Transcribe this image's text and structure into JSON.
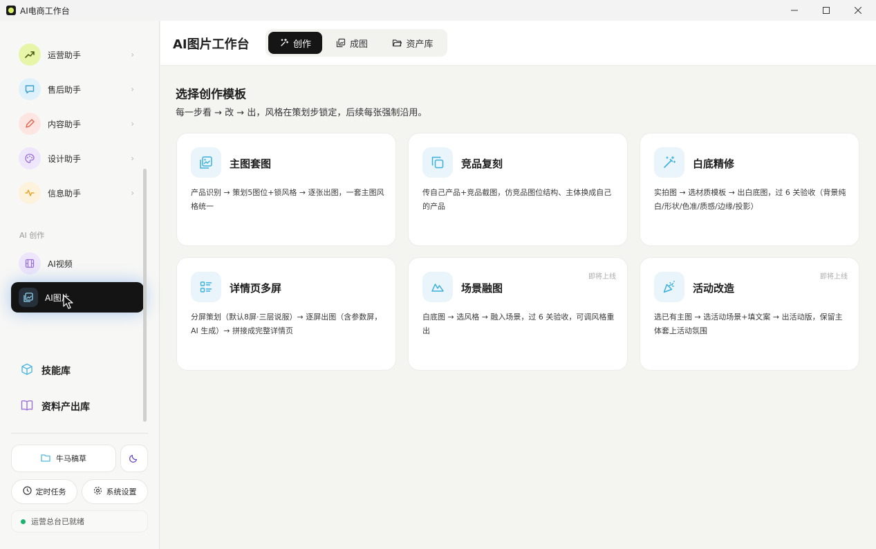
{
  "app": {
    "title": "AI电商工作台"
  },
  "sidebar": {
    "assistants": [
      {
        "label": "运营助手",
        "icon": "trend-up-icon",
        "color": "#e6f5a8"
      },
      {
        "label": "售后助手",
        "icon": "chat-bubble-icon",
        "color": "#dff1fb"
      },
      {
        "label": "内容助手",
        "icon": "pen-icon",
        "color": "#fde6e2"
      },
      {
        "label": "设计助手",
        "icon": "palette-icon",
        "color": "#eee6fa"
      },
      {
        "label": "信息助手",
        "icon": "pulse-icon",
        "color": "#fdf2dc"
      }
    ],
    "section_label": "AI 创作",
    "creation": [
      {
        "label": "AI视频",
        "icon": "film-icon"
      },
      {
        "label": "AI图片",
        "icon": "image-icon"
      }
    ],
    "library": [
      {
        "label": "技能库",
        "icon": "cube-icon"
      },
      {
        "label": "资料产出库",
        "icon": "book-icon"
      }
    ],
    "draft_box": "牛马稿草",
    "scheduled_tasks": "定时任务",
    "settings": "系统设置",
    "status_text": "运营总台已就绪"
  },
  "header": {
    "title": "AI图片工作台",
    "tabs": [
      {
        "label": "创作",
        "icon": "sparkle-icon"
      },
      {
        "label": "成图",
        "icon": "gallery-icon"
      },
      {
        "label": "资产库",
        "icon": "folder-icon"
      }
    ]
  },
  "main": {
    "title": "选择创作模板",
    "subtitle": "每一步看 → 改 → 出，风格在策划步锁定，后续每张强制沿用。",
    "cards": [
      {
        "title": "主图套图",
        "icon": "image-stack-icon",
        "desc": "产品识别 → 策划5图位+锁风格 → 逐张出图，一套主图风格统一",
        "badge": ""
      },
      {
        "title": "竞品复刻",
        "icon": "copy-icon",
        "desc": "传自己产品+竞品截图，仿竞品图位结构、主体换成自己的产品",
        "badge": ""
      },
      {
        "title": "白底精修",
        "icon": "magic-wand-icon",
        "desc": "实拍图 → 选材质模板 → 出白底图，过 6 关验收（背景纯白/形状/色准/质感/边缘/投影）",
        "badge": ""
      },
      {
        "title": "详情页多屏",
        "icon": "list-layout-icon",
        "desc": "分屏策划（默认8屏·三层说服）→ 逐屏出图（含参数屏，AI 生成）→ 拼接成完整详情页",
        "badge": ""
      },
      {
        "title": "场景融图",
        "icon": "mountain-icon",
        "desc": "白底图 → 选风格 → 融入场景，过 6 关验收，可调风格重出",
        "badge": "即将上线"
      },
      {
        "title": "活动改造",
        "icon": "party-popper-icon",
        "desc": "选已有主图 → 选活动场景+填文案 → 出活动版，保留主体套上活动氛围",
        "badge": "即将上线"
      }
    ]
  }
}
